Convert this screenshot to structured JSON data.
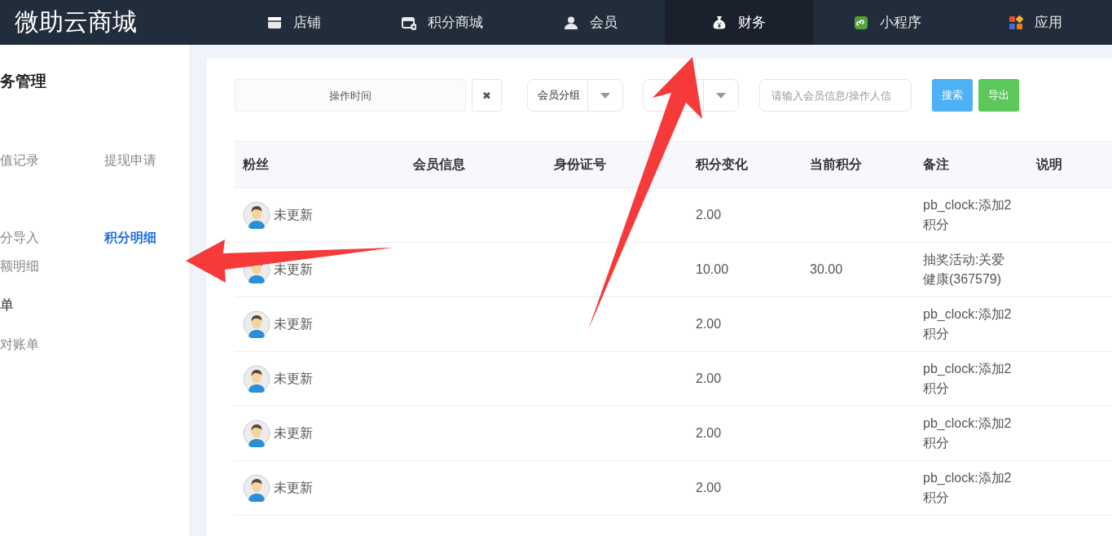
{
  "header": {
    "logo": "微助云商城",
    "nav": [
      {
        "label": "店铺",
        "selected": false
      },
      {
        "label": "积分商城",
        "selected": false
      },
      {
        "label": "会员",
        "selected": false
      },
      {
        "label": "财务",
        "selected": true
      },
      {
        "label": "小程序",
        "selected": false
      },
      {
        "label": "应用",
        "selected": false
      }
    ]
  },
  "sidebar": {
    "title": "务管理",
    "groups": [
      {
        "items": [
          {
            "label": "值记录",
            "selected": false
          },
          {
            "label": "提现申请",
            "selected": false
          }
        ]
      },
      {
        "items": [
          {
            "label": "分导入",
            "selected": false
          },
          {
            "label": "积分明细",
            "selected": true
          },
          {
            "label": "额明细",
            "selected": false
          }
        ]
      },
      {
        "heading": "单",
        "items": [
          {
            "label": "对账单",
            "selected": false
          }
        ]
      }
    ]
  },
  "filters": {
    "date_field": {
      "placeholder": "操作时间"
    },
    "clear_button": "✖",
    "group_select": {
      "value": "会员分组"
    },
    "search_field": {
      "placeholder": "请输入会员信息/操作人信"
    },
    "buttons": [
      "搜索",
      "导出"
    ]
  },
  "table": {
    "columns": [
      "粉丝",
      "会员信息",
      "身份证号",
      "积分变化",
      "当前积分",
      "备注",
      "说明"
    ],
    "rows": [
      {
        "fan": "未更新",
        "change": "2.00",
        "note": "pb_clock:添加2积分"
      },
      {
        "fan": "未更新",
        "change": "10.00",
        "current": "30.00",
        "note": "抽奖活动:关爱健康(367579)"
      },
      {
        "fan": "未更新",
        "change": "2.00",
        "note": "pb_clock:添加2积分"
      },
      {
        "fan": "未更新",
        "change": "2.00",
        "note": "pb_clock:添加2积分"
      },
      {
        "fan": "未更新",
        "change": "2.00",
        "note": "pb_clock:添加2积分"
      },
      {
        "fan": "未更新",
        "change": "2.00",
        "note": "pb_clock:添加2积分"
      }
    ]
  }
}
